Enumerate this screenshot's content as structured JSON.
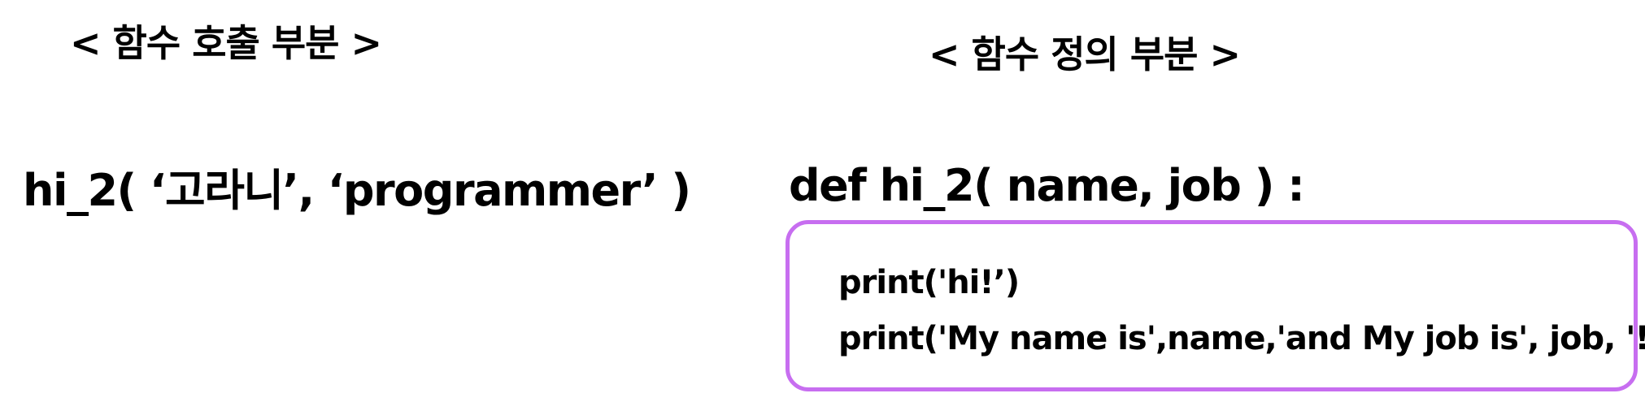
{
  "left": {
    "heading": "< 함수 호출 부분 >",
    "code": "hi_2( ‘고라니’, ‘programmer’ )"
  },
  "right": {
    "heading": "< 함수 정의 부분 >",
    "code": "def hi_2( name, job ) :",
    "body": [
      "print('hi!’)",
      "print('My name is',name,'and My job is', job, '!')"
    ]
  },
  "colors": {
    "box_border": "#c76ef0",
    "text": "#000000",
    "background": "#ffffff"
  }
}
